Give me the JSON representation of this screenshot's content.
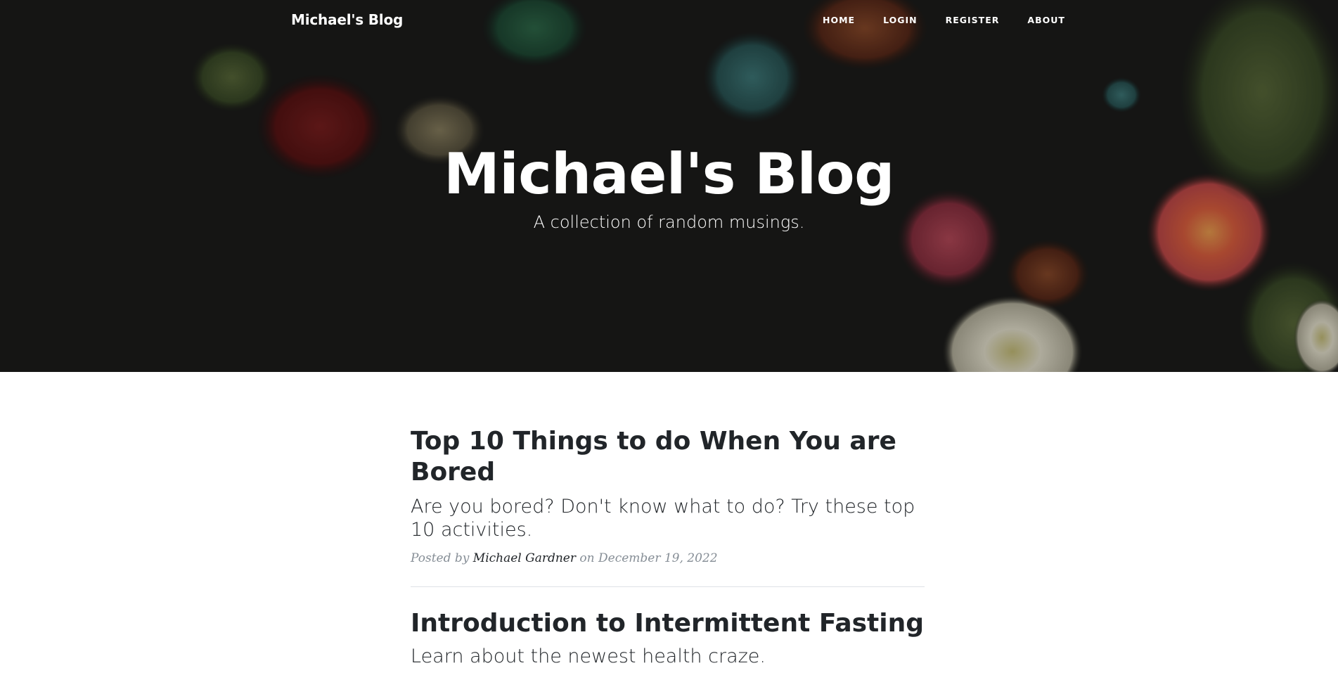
{
  "navbar": {
    "brand": "Michael's Blog",
    "links": [
      {
        "label": "HOME"
      },
      {
        "label": "LOGIN"
      },
      {
        "label": "REGISTER"
      },
      {
        "label": "ABOUT"
      }
    ]
  },
  "hero": {
    "title": "Michael's Blog",
    "subtitle": "A collection of random musings."
  },
  "posts": [
    {
      "title": "Top 10 Things to do When You are Bored",
      "subtitle": "Are you bored? Don't know what to do? Try these top 10 activities.",
      "meta_prefix": "Posted by",
      "author": "Michael Gardner",
      "meta_on": "on",
      "date": "December 19, 2022"
    },
    {
      "title": "Introduction to Intermittent Fasting",
      "subtitle": "Learn about the newest health craze."
    }
  ],
  "colors": {
    "text_dark": "#212529",
    "meta_gray": "#868e96",
    "hero_overlay": "#1b1b1a"
  }
}
